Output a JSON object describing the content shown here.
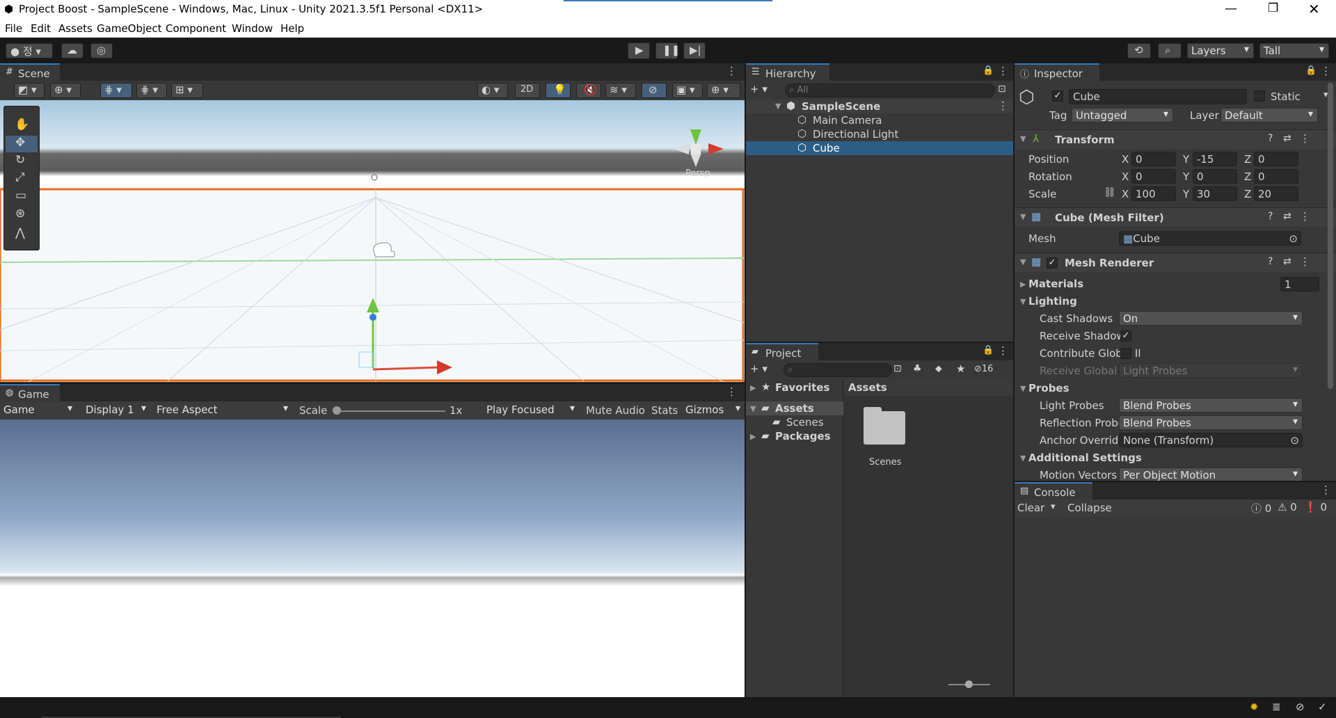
{
  "window": {
    "title": "Project Boost - SampleScene - Windows, Mac, Linux - Unity 2021.3.5f1 Personal <DX11>"
  },
  "menu": [
    "File",
    "Edit",
    "Assets",
    "GameObject",
    "Component",
    "Window",
    "Help"
  ],
  "toolbar": {
    "layers": "Layers",
    "layout": "Tall"
  },
  "scene": {
    "tab": "Scene",
    "mode2d": "2D",
    "persp": "Persp"
  },
  "game": {
    "tab": "Game",
    "view": "Game",
    "display": "Display 1",
    "aspect": "Free Aspect",
    "scale_label": "Scale",
    "scale_value": "1x",
    "play_mode": "Play Focused",
    "mute": "Mute Audio",
    "stats": "Stats",
    "gizmos": "Gizmos"
  },
  "hierarchy": {
    "tab": "Hierarchy",
    "search_placeholder": "All",
    "scene": "SampleScene",
    "items": [
      "Main Camera",
      "Directional Light",
      "Cube"
    ]
  },
  "project": {
    "tab": "Project",
    "count": "16",
    "favorites": "Favorites",
    "assets": "Assets",
    "scenes": "Scenes",
    "packages": "Packages",
    "breadcrumb": "Assets",
    "folder": "Scenes"
  },
  "inspector": {
    "tab": "Inspector",
    "name": "Cube",
    "static": "Static",
    "tag_label": "Tag",
    "tag": "Untagged",
    "layer_label": "Layer",
    "layer": "Default",
    "transform": {
      "title": "Transform",
      "rows": [
        {
          "label": "Position",
          "x": "0",
          "y": "-15",
          "z": "0"
        },
        {
          "label": "Rotation",
          "x": "0",
          "y": "0",
          "z": "0"
        },
        {
          "label": "Scale",
          "x": "100",
          "y": "30",
          "z": "20"
        }
      ]
    },
    "mesh_filter": {
      "title": "Cube (Mesh Filter)",
      "mesh_label": "Mesh",
      "mesh": "Cube"
    },
    "mesh_renderer": {
      "title": "Mesh Renderer",
      "materials": "Materials",
      "materials_count": "1",
      "lighting": "Lighting",
      "cast_shadows_label": "Cast Shadows",
      "cast_shadows": "On",
      "receive_shadows_label": "Receive Shadows",
      "contribute_gi_label": "Contribute Global Il",
      "receive_gi_label": "Receive Global Illur",
      "receive_gi": "Light Probes",
      "probes": "Probes",
      "light_probes_label": "Light Probes",
      "light_probes": "Blend Probes",
      "reflection_probes_label": "Reflection Probes",
      "reflection_probes": "Blend Probes",
      "anchor_label": "Anchor Override",
      "anchor": "None (Transform)",
      "additional": "Additional Settings",
      "motion_label": "Motion Vectors",
      "motion": "Per Object Motion"
    }
  },
  "console": {
    "tab": "Console",
    "clear": "Clear",
    "collapse": "Collapse",
    "logs": "0",
    "warnings": "0",
    "errors": "0"
  }
}
